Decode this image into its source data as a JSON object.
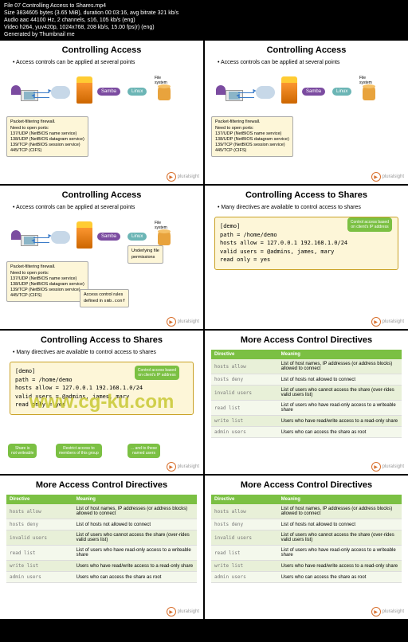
{
  "header": {
    "file": "File 07 Controlling Access to Shares.mp4",
    "size": "Size 3834605 bytes (3.65 MiB), duration 00:03:16, avg bitrate 321 kb/s",
    "audio": "Audio aac 44100 Hz, 2 channels, s16, 105 kb/s (eng)",
    "video": "Video h264, yuv420p, 1024x768, 208 kb/s, 15.00 fps(r) (eng)",
    "gen": "Generated by Thumbnail me"
  },
  "slides": {
    "controlling_access": "Controlling Access",
    "controlling_shares": "Controlling Access to Shares",
    "more_directives": "More Access Control Directives",
    "bullet_points": "Access controls can be applied at several points",
    "bullet_shares": "Many directives are available to control access to shares"
  },
  "network": {
    "samba": "Samba",
    "linux": "Linux",
    "filesystem": "File\nsystem"
  },
  "ports": {
    "title": "Packet-filtering firewall.",
    "need": "Need to open ports:",
    "p1": "137/UDP (NetBIOS name service)",
    "p2": "138/UDP (NetBIOS datagram service)",
    "p3": "139/TCP (NetBIOS session service)",
    "p4": "445/TCP (CIFS)"
  },
  "callouts": {
    "access_rules": "Access control rules\ndefined in smb.conf",
    "underlying": "Underlying file\npermissions",
    "ip_control": "Control access based\non client's IP address",
    "not_writeable": "Share is\nnot writeable",
    "restrict_group": "Restrict access to\nmembers of this group",
    "named_users": "... and to these\nnamed users"
  },
  "demo": {
    "l1": "[demo]",
    "l2": "  path = /home/demo",
    "l3": "  hosts allow = 127.0.0.1  192.168.1.0/24",
    "l4": "  valid users = @admins, james, mary",
    "l5": "  read only = yes"
  },
  "table": {
    "h1": "Directive",
    "h2": "Meaning",
    "rows": [
      {
        "d": "hosts allow",
        "m": "List of host names, IP addresses (or address blocks) allowed to connect"
      },
      {
        "d": "hosts deny",
        "m": "List of hosts not allowed to connect"
      },
      {
        "d": "invalid users",
        "m": "List of users who cannot access the share (over-rides valid users list)"
      },
      {
        "d": "read list",
        "m": "List of users who have read-only access to a writeable share"
      },
      {
        "d": "write list",
        "m": "Users who have read/write access to a read-only share"
      },
      {
        "d": "admin users",
        "m": "Users who can access the share as root"
      }
    ]
  },
  "logo": "pluralsight",
  "watermark": "www.cg-ku.com"
}
